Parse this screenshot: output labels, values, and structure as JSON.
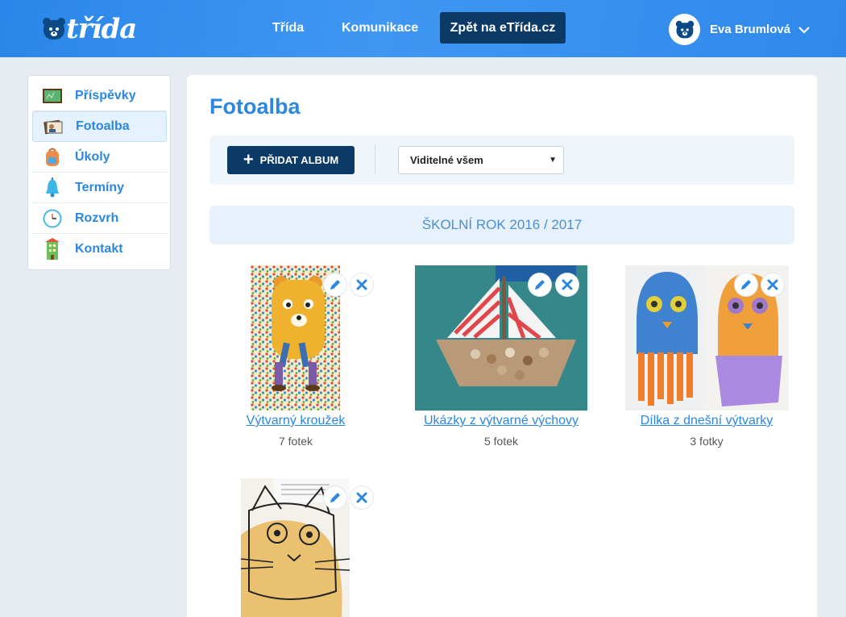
{
  "header": {
    "logo_text": "třída",
    "nav": [
      "Třída",
      "Komunikace"
    ],
    "back_button": "Zpět na eTřída.cz",
    "user_name": "Eva Brumlová"
  },
  "sidebar": {
    "items": [
      {
        "label": "Příspěvky",
        "icon": "blackboard-icon"
      },
      {
        "label": "Fotoalba",
        "icon": "photo-album-icon",
        "active": true
      },
      {
        "label": "Úkoly",
        "icon": "backpack-icon"
      },
      {
        "label": "Termíny",
        "icon": "bell-icon"
      },
      {
        "label": "Rozvrh",
        "icon": "clock-icon"
      },
      {
        "label": "Kontakt",
        "icon": "school-building-icon"
      }
    ]
  },
  "main": {
    "title": "Fotoalba",
    "add_album_label": "PŘIDAT ALBUM",
    "visibility_value": "Viditelné všem",
    "year_label": "ŠKOLNÍ ROK 2016 / 2017",
    "albums": [
      {
        "title": "Výtvarný kroužek",
        "count": "7 fotek"
      },
      {
        "title": "Ukázky z výtvarné výchovy",
        "count": "5 fotek"
      },
      {
        "title": "Dílka z dnešní výtvarky",
        "count": "3 fotky"
      },
      {
        "title": "",
        "count": ""
      }
    ]
  },
  "colors": {
    "accent": "#2b87e0",
    "dark_button": "#0c3a66",
    "header_blue": "#3a92ee"
  }
}
